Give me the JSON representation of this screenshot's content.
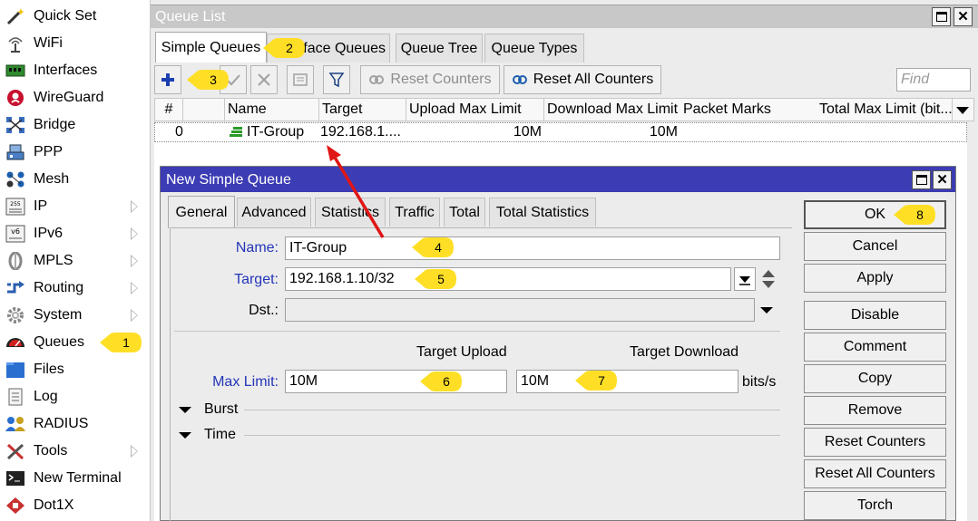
{
  "sidebar": {
    "items": [
      {
        "label": "Quick Set",
        "icon": "magic-wand-icon",
        "has_submenu": false
      },
      {
        "label": "WiFi",
        "icon": "wifi-antenna-icon",
        "has_submenu": false
      },
      {
        "label": "Interfaces",
        "icon": "interfaces-icon",
        "has_submenu": false
      },
      {
        "label": "WireGuard",
        "icon": "wireguard-icon",
        "has_submenu": false
      },
      {
        "label": "Bridge",
        "icon": "bridge-icon",
        "has_submenu": false
      },
      {
        "label": "PPP",
        "icon": "ppp-icon",
        "has_submenu": false
      },
      {
        "label": "Mesh",
        "icon": "mesh-icon",
        "has_submenu": false
      },
      {
        "label": "IP",
        "icon": "ip-icon",
        "has_submenu": true
      },
      {
        "label": "IPv6",
        "icon": "ipv6-icon",
        "has_submenu": true
      },
      {
        "label": "MPLS",
        "icon": "mpls-icon",
        "has_submenu": true
      },
      {
        "label": "Routing",
        "icon": "routing-icon",
        "has_submenu": true
      },
      {
        "label": "System",
        "icon": "gear-icon",
        "has_submenu": true
      },
      {
        "label": "Queues",
        "icon": "queues-icon",
        "has_submenu": false
      },
      {
        "label": "Files",
        "icon": "folder-icon",
        "has_submenu": false
      },
      {
        "label": "Log",
        "icon": "log-icon",
        "has_submenu": false
      },
      {
        "label": "RADIUS",
        "icon": "radius-icon",
        "has_submenu": false
      },
      {
        "label": "Tools",
        "icon": "tools-icon",
        "has_submenu": true
      },
      {
        "label": "New Terminal",
        "icon": "terminal-icon",
        "has_submenu": false
      },
      {
        "label": "Dot1X",
        "icon": "dot1x-icon",
        "has_submenu": false
      }
    ]
  },
  "queue_window": {
    "title": "Queue List",
    "tabs": [
      "Simple Queues",
      "Interface Queues",
      "Queue Tree",
      "Queue Types"
    ],
    "active_tab": "Simple Queues",
    "toolbar": {
      "reset_counters": "Reset Counters",
      "reset_all_counters": "Reset All Counters",
      "find_placeholder": "Find"
    },
    "columns": [
      "#",
      "",
      "Name",
      "Target",
      "Upload Max Limit",
      "Download Max Limit",
      "Packet Marks",
      "Total Max Limit (bit..."
    ],
    "rows": [
      {
        "num": "0",
        "name": "IT-Group",
        "target": "192.168.1....",
        "upload": "10M",
        "download": "10M",
        "packet_marks": "",
        "total": ""
      }
    ]
  },
  "dialog": {
    "title": "New Simple Queue",
    "tabs": [
      "General",
      "Advanced",
      "Statistics",
      "Traffic",
      "Total",
      "Total Statistics"
    ],
    "active_tab": "General",
    "fields": {
      "name_label": "Name:",
      "name_value": "IT-Group",
      "target_label": "Target:",
      "target_value": "192.168.1.10/32",
      "dst_label": "Dst.:",
      "dst_value": "",
      "target_upload_header": "Target Upload",
      "target_download_header": "Target Download",
      "max_limit_label": "Max Limit:",
      "max_limit_upload": "10M",
      "max_limit_download": "10M",
      "units": "bits/s",
      "burst_label": "Burst",
      "time_label": "Time"
    },
    "buttons": [
      "OK",
      "Cancel",
      "Apply",
      "Disable",
      "Comment",
      "Copy",
      "Remove",
      "Reset Counters",
      "Reset All Counters",
      "Torch"
    ]
  },
  "callouts": [
    "1",
    "2",
    "3",
    "4",
    "5",
    "6",
    "7",
    "8"
  ],
  "colors": {
    "dialog_title": "#3c3cb4",
    "field_label_blue": "#2436b8",
    "callout_yellow": "#ffdf26",
    "arrow_red": "#e01616",
    "add_blue": "#1c3fb0"
  }
}
